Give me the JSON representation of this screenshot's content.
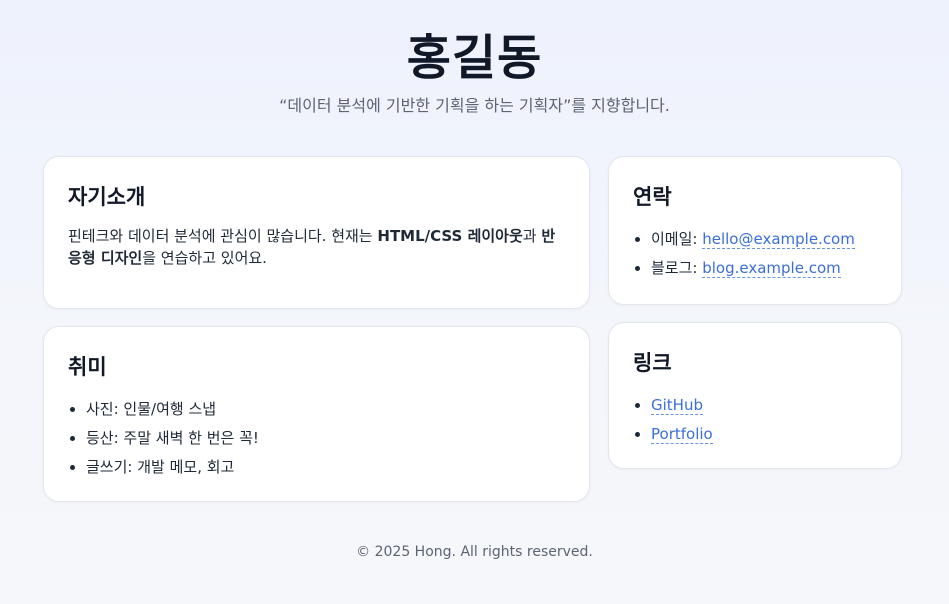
{
  "header": {
    "name": "홍길동",
    "tagline": "“데이터 분석에 기반한 기획을 하는 기획자”를 지향합니다."
  },
  "intro": {
    "title": "자기소개",
    "text_1": "핀테크와 데이터 분석에 관심이 많습니다. 현재는 ",
    "bold_1": "HTML/CSS 레이아웃",
    "text_2": "과 ",
    "bold_2": "반응형 디자인",
    "text_3": "을 연습하고 있어요."
  },
  "hobby": {
    "title": "취미",
    "items": [
      "사진: 인물/여행 스냅",
      "등산: 주말 새벽 한 번은 꼭!",
      "글쓰기: 개발 메모, 회고"
    ]
  },
  "contact": {
    "title": "연락",
    "email_label": "이메일: ",
    "email": "hello@example.com",
    "blog_label": "블로그: ",
    "blog": "blog.example.com"
  },
  "links": {
    "title": "링크",
    "items": [
      "GitHub",
      "Portfolio"
    ]
  },
  "footer": {
    "text": "© 2025 Hong. All rights reserved."
  },
  "colors": {
    "link": "#3b6fd8",
    "heading": "#111827",
    "muted": "#5b6375"
  }
}
